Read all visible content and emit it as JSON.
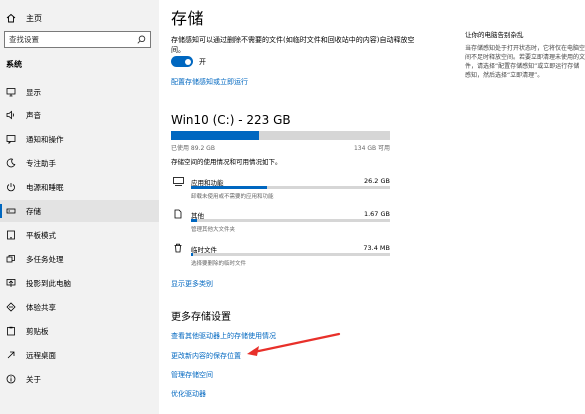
{
  "sidebar": {
    "home_label": "主页",
    "search_placeholder": "查找设置",
    "section_title": "系统",
    "items": [
      {
        "label": "显示",
        "icon": "monitor-icon"
      },
      {
        "label": "声音",
        "icon": "speaker-icon"
      },
      {
        "label": "通知和操作",
        "icon": "notification-icon"
      },
      {
        "label": "专注助手",
        "icon": "moon-icon"
      },
      {
        "label": "电源和睡眠",
        "icon": "power-icon"
      },
      {
        "label": "存储",
        "icon": "storage-icon",
        "active": true
      },
      {
        "label": "平板模式",
        "icon": "tablet-icon"
      },
      {
        "label": "多任务处理",
        "icon": "multitask-icon"
      },
      {
        "label": "投影到此电脑",
        "icon": "project-icon"
      },
      {
        "label": "体验共享",
        "icon": "share-icon"
      },
      {
        "label": "剪贴板",
        "icon": "clipboard-icon"
      },
      {
        "label": "远程桌面",
        "icon": "remote-icon"
      },
      {
        "label": "关于",
        "icon": "info-icon"
      }
    ]
  },
  "main": {
    "title": "存储",
    "description": "存储感知可以通过删除不需要的文件(如临时文件和回收站中的内容)自动释放空间。",
    "toggle_label": "开",
    "toggle_on": true,
    "configure_link": "配置存储感知或立即运行",
    "drive": {
      "title": "Win10 (C:) - 223 GB",
      "used": "已使用 89.2 GB",
      "free": "134 GB 可用",
      "used_fraction": 0.4
    },
    "breakdown_desc": "存储空间的使用情况和可用情况如下。",
    "categories": [
      {
        "name": "应用和功能",
        "size": "26.2 GB",
        "sub": "卸载未使用或不需要的应用和功能",
        "fraction": 0.38,
        "icon": "apps-icon"
      },
      {
        "name": "其他",
        "size": "1.67 GB",
        "sub": "管理其他大文件夹",
        "fraction": 0.03,
        "icon": "other-icon"
      },
      {
        "name": "临时文件",
        "size": "73.4 MB",
        "sub": "选择要删除的临时文件",
        "fraction": 0.01,
        "icon": "trash-icon"
      }
    ],
    "show_more": "显示更多类别",
    "more_title": "更多存储设置",
    "more_links": [
      "查看其他驱动器上的存储使用情况",
      "更改新内容的保存位置",
      "管理存储空间",
      "优化驱动器"
    ]
  },
  "right": {
    "tip_title": "让你的电脑告别杂乱",
    "tip_text": "当存储感知处于打开状态时，它将仅在电脑空间不足时释放空间。若要立即清理未使用的文件，请选择“配置存储感知”或立即运行存储感知，然后选择“立即清理”。"
  },
  "colors": {
    "accent": "#0067c0",
    "annotation_arrow": "#e8302a"
  }
}
